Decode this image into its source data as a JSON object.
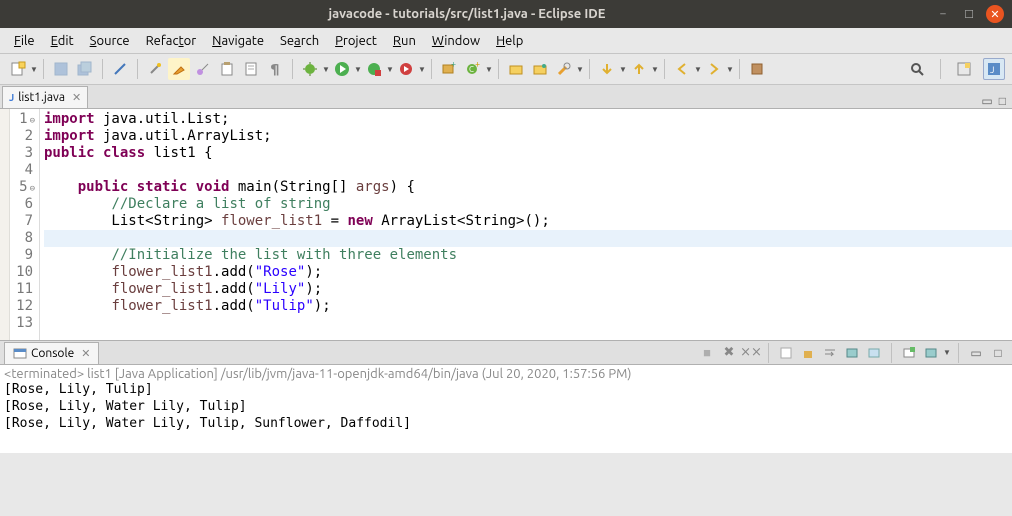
{
  "window": {
    "title": "javacode - tutorials/src/list1.java - Eclipse IDE"
  },
  "menu": {
    "file": "File",
    "edit": "Edit",
    "source": "Source",
    "refactor": "Refactor",
    "navigate": "Navigate",
    "search": "Search",
    "project": "Project",
    "run": "Run",
    "window": "Window",
    "help": "Help"
  },
  "editor": {
    "tab_filename": "list1.java",
    "code": {
      "l1": "import java.util.List;",
      "l2": "import java.util.ArrayList;",
      "l3": "public class list1 {",
      "l5": "    public static void main(String[] args) {",
      "l6": "        //Declare a list of string",
      "l7_a": "        List<String> ",
      "l7_b": "flower_list1",
      "l7_c": " = new ArrayList<String>();",
      "l9": "        //Initialize the list with three elements",
      "l10_a": "        ",
      "l10_b": "flower_list1",
      "l10_c": ".add(",
      "l10_d": "\"Rose\"",
      "l10_e": ");",
      "l11_d": "\"Lily\"",
      "l12_d": "\"Tulip\""
    },
    "line_numbers": [
      "1",
      "2",
      "3",
      "4",
      "5",
      "6",
      "7",
      "8",
      "9",
      "10",
      "11",
      "12",
      "13"
    ]
  },
  "console": {
    "tab_label": "Console",
    "header": "<terminated> list1 [Java Application] /usr/lib/jvm/java-11-openjdk-amd64/bin/java (Jul 20, 2020, 1:57:56 PM)",
    "out1": "[Rose, Lily, Tulip]",
    "out2": "[Rose, Lily, Water Lily, Tulip]",
    "out3": "[Rose, Lily, Water Lily, Tulip, Sunflower, Daffodil]"
  }
}
